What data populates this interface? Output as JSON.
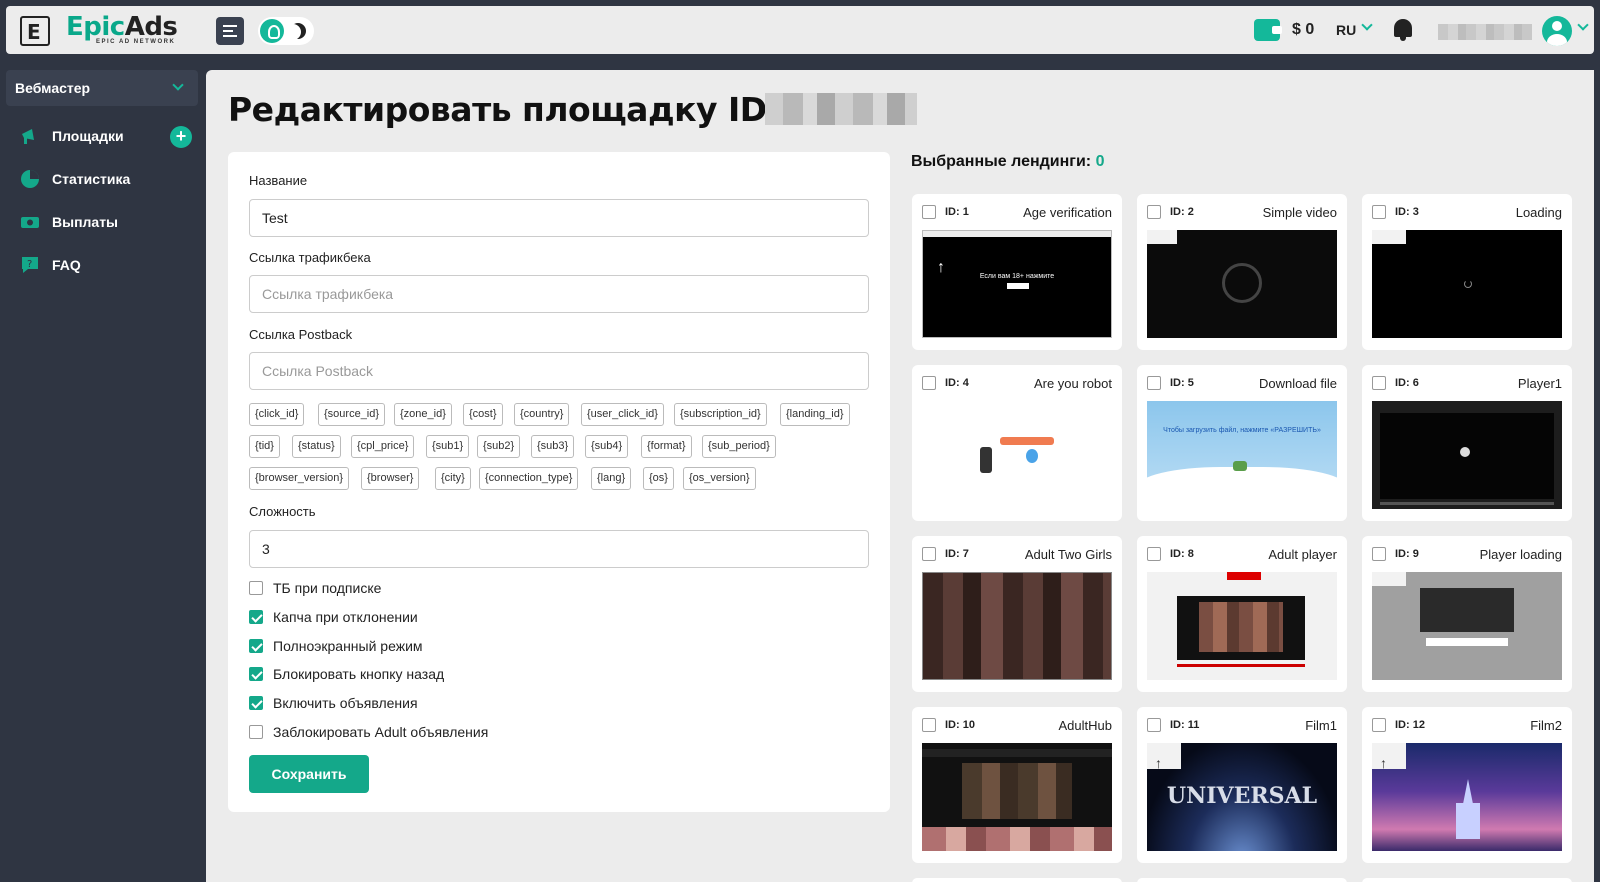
{
  "header": {
    "logo_letter": "E",
    "logo_brand_a": "Epic",
    "logo_brand_b": "Ads",
    "logo_tagline": "EPIC AD NETWORK",
    "balance": "$ 0",
    "language": "RU"
  },
  "sidebar": {
    "section": "Вебмастер",
    "items": [
      {
        "label": "Площадки",
        "icon": "megaphone-icon"
      },
      {
        "label": "Статистика",
        "icon": "chart-pie-icon"
      },
      {
        "label": "Выплаты",
        "icon": "money-icon"
      },
      {
        "label": "FAQ",
        "icon": "chat-question-icon"
      }
    ],
    "add_label": "+"
  },
  "page": {
    "title": "Редактировать площадку ID: 1"
  },
  "form": {
    "name_label": "Название",
    "name_value": "Test",
    "tb_label": "Ссылка трафикбека",
    "tb_placeholder": "Ссылка трафикбека",
    "postback_label": "Ссылка Postback",
    "postback_placeholder": "Ссылка Postback",
    "macros": [
      "{click_id}",
      "{source_id}",
      "{zone_id}",
      "{cost}",
      "{country}",
      "{user_click_id}",
      "{subscription_id}",
      "{landing_id}",
      "{tid}",
      "{status}",
      "{cpl_price}",
      "{sub1}",
      "{sub2}",
      "{sub3}",
      "{sub4}",
      "{format}",
      "{sub_period}",
      "{browser_version}",
      "{browser}",
      "{city}",
      "{connection_type}",
      "{lang}",
      "{os}",
      "{os_version}"
    ],
    "difficulty_label": "Сложность",
    "difficulty_value": "3",
    "options": [
      {
        "label": "ТБ при подписке",
        "checked": false
      },
      {
        "label": "Капча при отклонении",
        "checked": true
      },
      {
        "label": "Полноэкранный режим",
        "checked": true
      },
      {
        "label": "Блокировать кнопку назад",
        "checked": true
      },
      {
        "label": "Включить объявления",
        "checked": true
      },
      {
        "label": "Заблокировать Adult объявления",
        "checked": false
      }
    ],
    "save_label": "Сохранить"
  },
  "landings": {
    "title": "Выбранные лендинги:",
    "count": "0",
    "items": [
      {
        "id": "ID: 1",
        "name": "Age verification",
        "thumb_text": "Если вам 18+ нажмите"
      },
      {
        "id": "ID: 2",
        "name": "Simple video"
      },
      {
        "id": "ID: 3",
        "name": "Loading"
      },
      {
        "id": "ID: 4",
        "name": "Are you robot"
      },
      {
        "id": "ID: 5",
        "name": "Download file",
        "thumb_text": "Чтобы загрузить файл, нажмите «РАЗРЕШИТЬ»"
      },
      {
        "id": "ID: 6",
        "name": "Player1"
      },
      {
        "id": "ID: 7",
        "name": "Adult Two Girls"
      },
      {
        "id": "ID: 8",
        "name": "Adult player"
      },
      {
        "id": "ID: 9",
        "name": "Player loading"
      },
      {
        "id": "ID: 10",
        "name": "AdultHub"
      },
      {
        "id": "ID: 11",
        "name": "Film1",
        "thumb_text": "UNIVERSAL"
      },
      {
        "id": "ID: 12",
        "name": "Film2"
      }
    ]
  }
}
